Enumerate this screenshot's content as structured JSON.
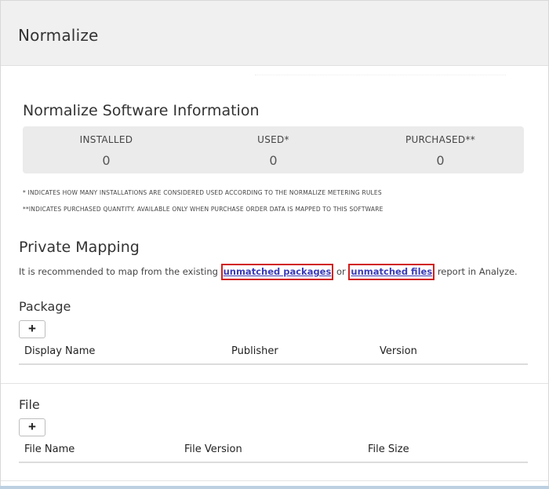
{
  "header": {
    "title": "Normalize"
  },
  "software_info": {
    "title": "Normalize Software Information",
    "stats": [
      {
        "label": "INSTALLED",
        "value": "0"
      },
      {
        "label": "USED*",
        "value": "0"
      },
      {
        "label": "PURCHASED**",
        "value": "0"
      }
    ],
    "notes": [
      "* INDICATES HOW MANY INSTALLATIONS ARE CONSIDERED USED ACCORDING TO THE NORMALIZE METERING RULES",
      "**INDICATES PURCHASED QUANTITY. AVAILABLE ONLY WHEN PURCHASE ORDER DATA IS MAPPED TO THIS SOFTWARE"
    ]
  },
  "private_mapping": {
    "title": "Private Mapping",
    "text_before": "It is recommended to map from the existing ",
    "link_packages": "unmatched packages",
    "text_or": " or ",
    "link_files": "unmatched files",
    "text_after": " report in Analyze."
  },
  "package": {
    "title": "Package",
    "add_label": "+",
    "columns": [
      "Display Name",
      "Publisher",
      "Version"
    ]
  },
  "file": {
    "title": "File",
    "add_label": "+",
    "columns": [
      "File Name",
      "File Version",
      "File Size"
    ]
  }
}
